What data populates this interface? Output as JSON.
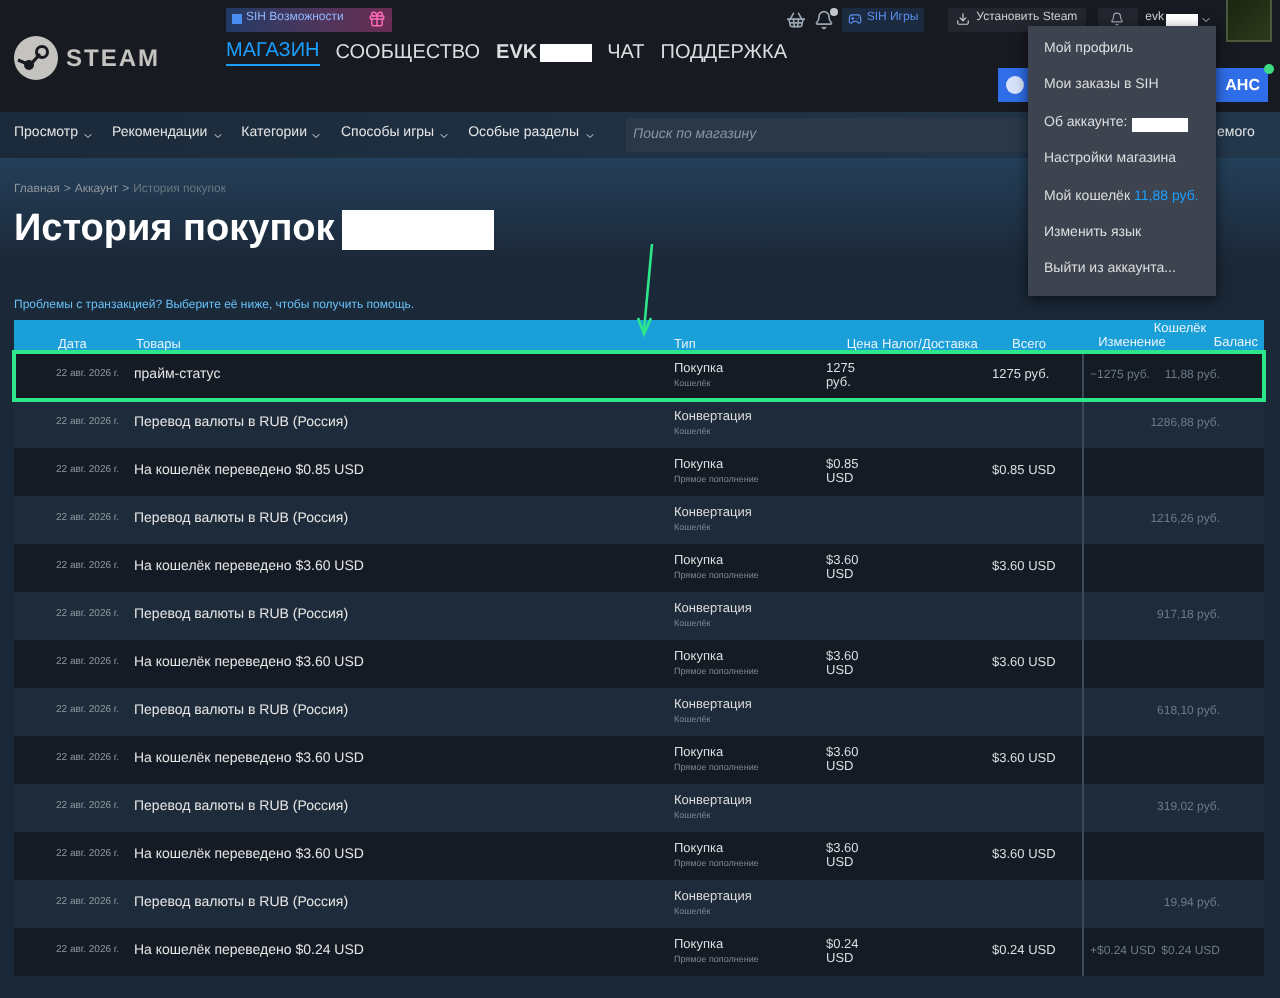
{
  "top_bar": {
    "promo_button": "SIH Возможности",
    "games_button": "SIH Игры",
    "install_button": "Установить Steam",
    "account_name": "evk"
  },
  "logo": {
    "text": "STEAM"
  },
  "main_nav": [
    {
      "label": "МАГАЗИН",
      "selected": true,
      "redacted": false
    },
    {
      "label": "СООБЩЕСТВО",
      "selected": false,
      "redacted": false
    },
    {
      "label": "EVK",
      "selected": false,
      "redacted": true
    },
    {
      "label": "ЧАТ",
      "selected": false,
      "redacted": false
    },
    {
      "label": "ПОДДЕРЖКА",
      "selected": false,
      "redacted": false
    }
  ],
  "partial_button": {
    "label": "АНС"
  },
  "store_nav": {
    "items": [
      "Просмотр",
      "Рекомендации",
      "Категории",
      "Способы игры",
      "Особые разделы"
    ],
    "search_placeholder": "Поиск по магазину",
    "cut_text": "емого"
  },
  "breadcrumb": {
    "separator": ">",
    "items": [
      "Главная",
      "Аккаунт",
      "История покупок"
    ]
  },
  "page_title": "История покупок",
  "help_link": "Проблемы с транзакцией? Выберите её ниже, чтобы получить помощь.",
  "table": {
    "columns": [
      "Дата",
      "Товары",
      "Тип",
      "Цена",
      "Налог/Доставка",
      "Всего",
      "Изменение",
      "Баланс"
    ],
    "wallet_group": "Кошелёк",
    "rows": [
      {
        "date": "22 авг. 2026 г.",
        "item": "прайм-статус",
        "type": "Покупка",
        "subtype": "Кошелёк",
        "price": "1275 руб.",
        "total": "1275 руб.",
        "change": "−1275 руб.",
        "balance": "11,88 руб.",
        "highlighted": true
      },
      {
        "date": "22 авг. 2026 г.",
        "item": "Перевод валюты в RUB (Россия)",
        "type": "Конвертация",
        "subtype": "Кошелёк",
        "balance": "1286,88 руб.",
        "highlighted": false
      },
      {
        "date": "22 авг. 2026 г.",
        "item": "На кошелёк переведено $0.85 USD",
        "type": "Покупка",
        "subtype": "Прямое пополнение",
        "price": "$0.85 USD",
        "total": "$0.85 USD",
        "highlighted": false
      },
      {
        "date": "22 авг. 2026 г.",
        "item": "Перевод валюты в RUB (Россия)",
        "type": "Конвертация",
        "subtype": "Кошелёк",
        "balance": "1216,26 руб.",
        "highlighted": false
      },
      {
        "date": "22 авг. 2026 г.",
        "item": "На кошелёк переведено $3.60 USD",
        "type": "Покупка",
        "subtype": "Прямое пополнение",
        "price": "$3.60 USD",
        "total": "$3.60 USD",
        "highlighted": false
      },
      {
        "date": "22 авг. 2026 г.",
        "item": "Перевод валюты в RUB (Россия)",
        "type": "Конвертация",
        "subtype": "Кошелёк",
        "balance": "917,18 руб.",
        "highlighted": false
      },
      {
        "date": "22 авг. 2026 г.",
        "item": "На кошелёк переведено $3.60 USD",
        "type": "Покупка",
        "subtype": "Прямое пополнение",
        "price": "$3.60 USD",
        "total": "$3.60 USD",
        "highlighted": false
      },
      {
        "date": "22 авг. 2026 г.",
        "item": "Перевод валюты в RUB (Россия)",
        "type": "Конвертация",
        "subtype": "Кошелёк",
        "balance": "618,10 руб.",
        "highlighted": false
      },
      {
        "date": "22 авг. 2026 г.",
        "item": "На кошелёк переведено $3.60 USD",
        "type": "Покупка",
        "subtype": "Прямое пополнение",
        "price": "$3.60 USD",
        "total": "$3.60 USD",
        "highlighted": false
      },
      {
        "date": "22 авг. 2026 г.",
        "item": "Перевод валюты в RUB (Россия)",
        "type": "Конвертация",
        "subtype": "Кошелёк",
        "balance": "319,02 руб.",
        "highlighted": false
      },
      {
        "date": "22 авг. 2026 г.",
        "item": "На кошелёк переведено $3.60 USD",
        "type": "Покупка",
        "subtype": "Прямое пополнение",
        "price": "$3.60 USD",
        "total": "$3.60 USD",
        "highlighted": false
      },
      {
        "date": "22 авг. 2026 г.",
        "item": "Перевод валюты в RUB (Россия)",
        "type": "Конвертация",
        "subtype": "Кошелёк",
        "balance": "19,94 руб.",
        "highlighted": false
      },
      {
        "date": "22 авг. 2026 г.",
        "item": "На кошелёк переведено $0.24 USD",
        "type": "Покупка",
        "subtype": "Прямое пополнение",
        "price": "$0.24 USD",
        "total": "$0.24 USD",
        "change": "+$0.24 USD",
        "balance": "$0.24 USD",
        "highlighted": false
      }
    ]
  },
  "account_menu": {
    "items": [
      {
        "label": "Мой профиль",
        "redacted": false
      },
      {
        "label": "Мои заказы в SIH",
        "redacted": false
      },
      {
        "label": "Об аккаунте:",
        "redacted": true
      },
      {
        "label": "Настройки магазина",
        "redacted": false
      },
      {
        "label": "Мой кошелёк",
        "value": "11,88 руб.",
        "redacted": false
      },
      {
        "label": "Изменить язык",
        "redacted": false
      },
      {
        "label": "Выйти из аккаунта...",
        "redacted": false
      }
    ]
  }
}
